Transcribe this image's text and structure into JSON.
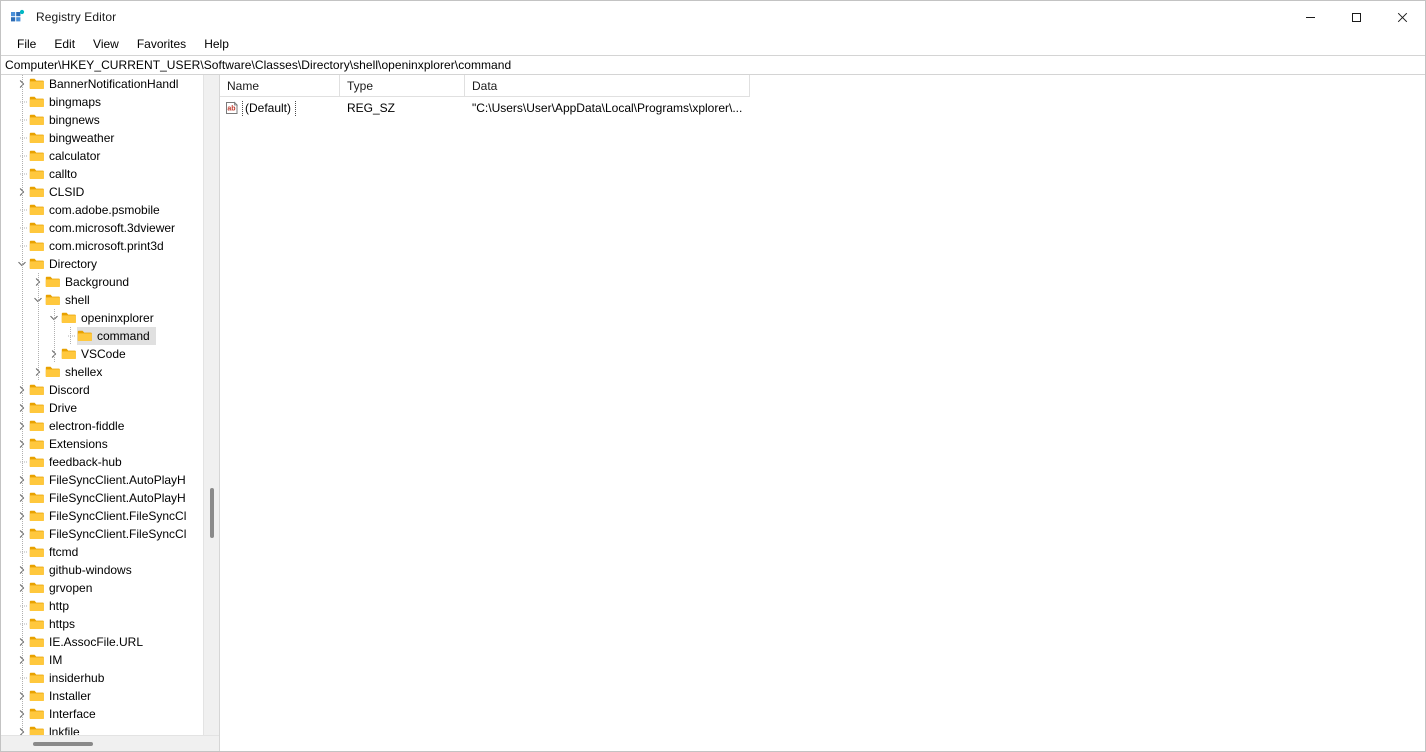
{
  "window": {
    "title": "Registry Editor",
    "icon": "registry-editor-icon",
    "caption_buttons": [
      {
        "name": "minimize",
        "glyph": "—"
      },
      {
        "name": "maximize",
        "glyph": "□"
      },
      {
        "name": "close",
        "glyph": "✕"
      }
    ]
  },
  "menubar": {
    "items": [
      {
        "label": "File"
      },
      {
        "label": "Edit"
      },
      {
        "label": "View"
      },
      {
        "label": "Favorites"
      },
      {
        "label": "Help"
      }
    ]
  },
  "address": {
    "path": "Computer\\HKEY_CURRENT_USER\\Software\\Classes\\Directory\\shell\\openinxplorer\\command"
  },
  "tree": {
    "items": [
      {
        "label": "BannerNotificationHandl",
        "indent": 1,
        "state": "collapsed",
        "selected": false
      },
      {
        "label": "bingmaps",
        "indent": 1,
        "state": "leaf",
        "selected": false
      },
      {
        "label": "bingnews",
        "indent": 1,
        "state": "leaf",
        "selected": false
      },
      {
        "label": "bingweather",
        "indent": 1,
        "state": "leaf",
        "selected": false
      },
      {
        "label": "calculator",
        "indent": 1,
        "state": "leaf",
        "selected": false
      },
      {
        "label": "callto",
        "indent": 1,
        "state": "leaf",
        "selected": false
      },
      {
        "label": "CLSID",
        "indent": 1,
        "state": "collapsed",
        "selected": false
      },
      {
        "label": "com.adobe.psmobile",
        "indent": 1,
        "state": "leaf",
        "selected": false
      },
      {
        "label": "com.microsoft.3dviewer",
        "indent": 1,
        "state": "leaf",
        "selected": false
      },
      {
        "label": "com.microsoft.print3d",
        "indent": 1,
        "state": "leaf",
        "selected": false
      },
      {
        "label": "Directory",
        "indent": 1,
        "state": "expanded",
        "selected": false
      },
      {
        "label": "Background",
        "indent": 2,
        "state": "collapsed",
        "selected": false
      },
      {
        "label": "shell",
        "indent": 2,
        "state": "expanded",
        "selected": false
      },
      {
        "label": "openinxplorer",
        "indent": 3,
        "state": "expanded",
        "selected": false
      },
      {
        "label": "command",
        "indent": 4,
        "state": "leaf",
        "selected": true
      },
      {
        "label": "VSCode",
        "indent": 3,
        "state": "collapsed",
        "selected": false
      },
      {
        "label": "shellex",
        "indent": 2,
        "state": "collapsed",
        "selected": false
      },
      {
        "label": "Discord",
        "indent": 1,
        "state": "collapsed",
        "selected": false
      },
      {
        "label": "Drive",
        "indent": 1,
        "state": "collapsed",
        "selected": false
      },
      {
        "label": "electron-fiddle",
        "indent": 1,
        "state": "collapsed",
        "selected": false
      },
      {
        "label": "Extensions",
        "indent": 1,
        "state": "collapsed",
        "selected": false
      },
      {
        "label": "feedback-hub",
        "indent": 1,
        "state": "leaf",
        "selected": false
      },
      {
        "label": "FileSyncClient.AutoPlayH",
        "indent": 1,
        "state": "collapsed",
        "selected": false
      },
      {
        "label": "FileSyncClient.AutoPlayH",
        "indent": 1,
        "state": "collapsed",
        "selected": false
      },
      {
        "label": "FileSyncClient.FileSyncCl",
        "indent": 1,
        "state": "collapsed",
        "selected": false
      },
      {
        "label": "FileSyncClient.FileSyncCl",
        "indent": 1,
        "state": "collapsed",
        "selected": false
      },
      {
        "label": "ftcmd",
        "indent": 1,
        "state": "leaf",
        "selected": false
      },
      {
        "label": "github-windows",
        "indent": 1,
        "state": "collapsed",
        "selected": false
      },
      {
        "label": "grvopen",
        "indent": 1,
        "state": "collapsed",
        "selected": false
      },
      {
        "label": "http",
        "indent": 1,
        "state": "leaf",
        "selected": false
      },
      {
        "label": "https",
        "indent": 1,
        "state": "leaf",
        "selected": false
      },
      {
        "label": "IE.AssocFile.URL",
        "indent": 1,
        "state": "collapsed",
        "selected": false
      },
      {
        "label": "IM",
        "indent": 1,
        "state": "collapsed",
        "selected": false
      },
      {
        "label": "insiderhub",
        "indent": 1,
        "state": "leaf",
        "selected": false
      },
      {
        "label": "Installer",
        "indent": 1,
        "state": "collapsed",
        "selected": false
      },
      {
        "label": "Interface",
        "indent": 1,
        "state": "collapsed",
        "selected": false
      },
      {
        "label": "lnkfile",
        "indent": 1,
        "state": "collapsed",
        "selected": false
      }
    ]
  },
  "values": {
    "columns": [
      {
        "label": "Name"
      },
      {
        "label": "Type"
      },
      {
        "label": "Data"
      }
    ],
    "rows": [
      {
        "icon": "string-value-icon",
        "name": "(Default)",
        "type": "REG_SZ",
        "data": "\"C:\\Users\\User\\AppData\\Local\\Programs\\xplorer\\..."
      }
    ]
  },
  "colors": {
    "folder": "#ffc83d",
    "folder_dark": "#e8a100",
    "selection": "#e0e0e0",
    "accent": "#0078d4",
    "string_icon_text": "#c0392b"
  }
}
